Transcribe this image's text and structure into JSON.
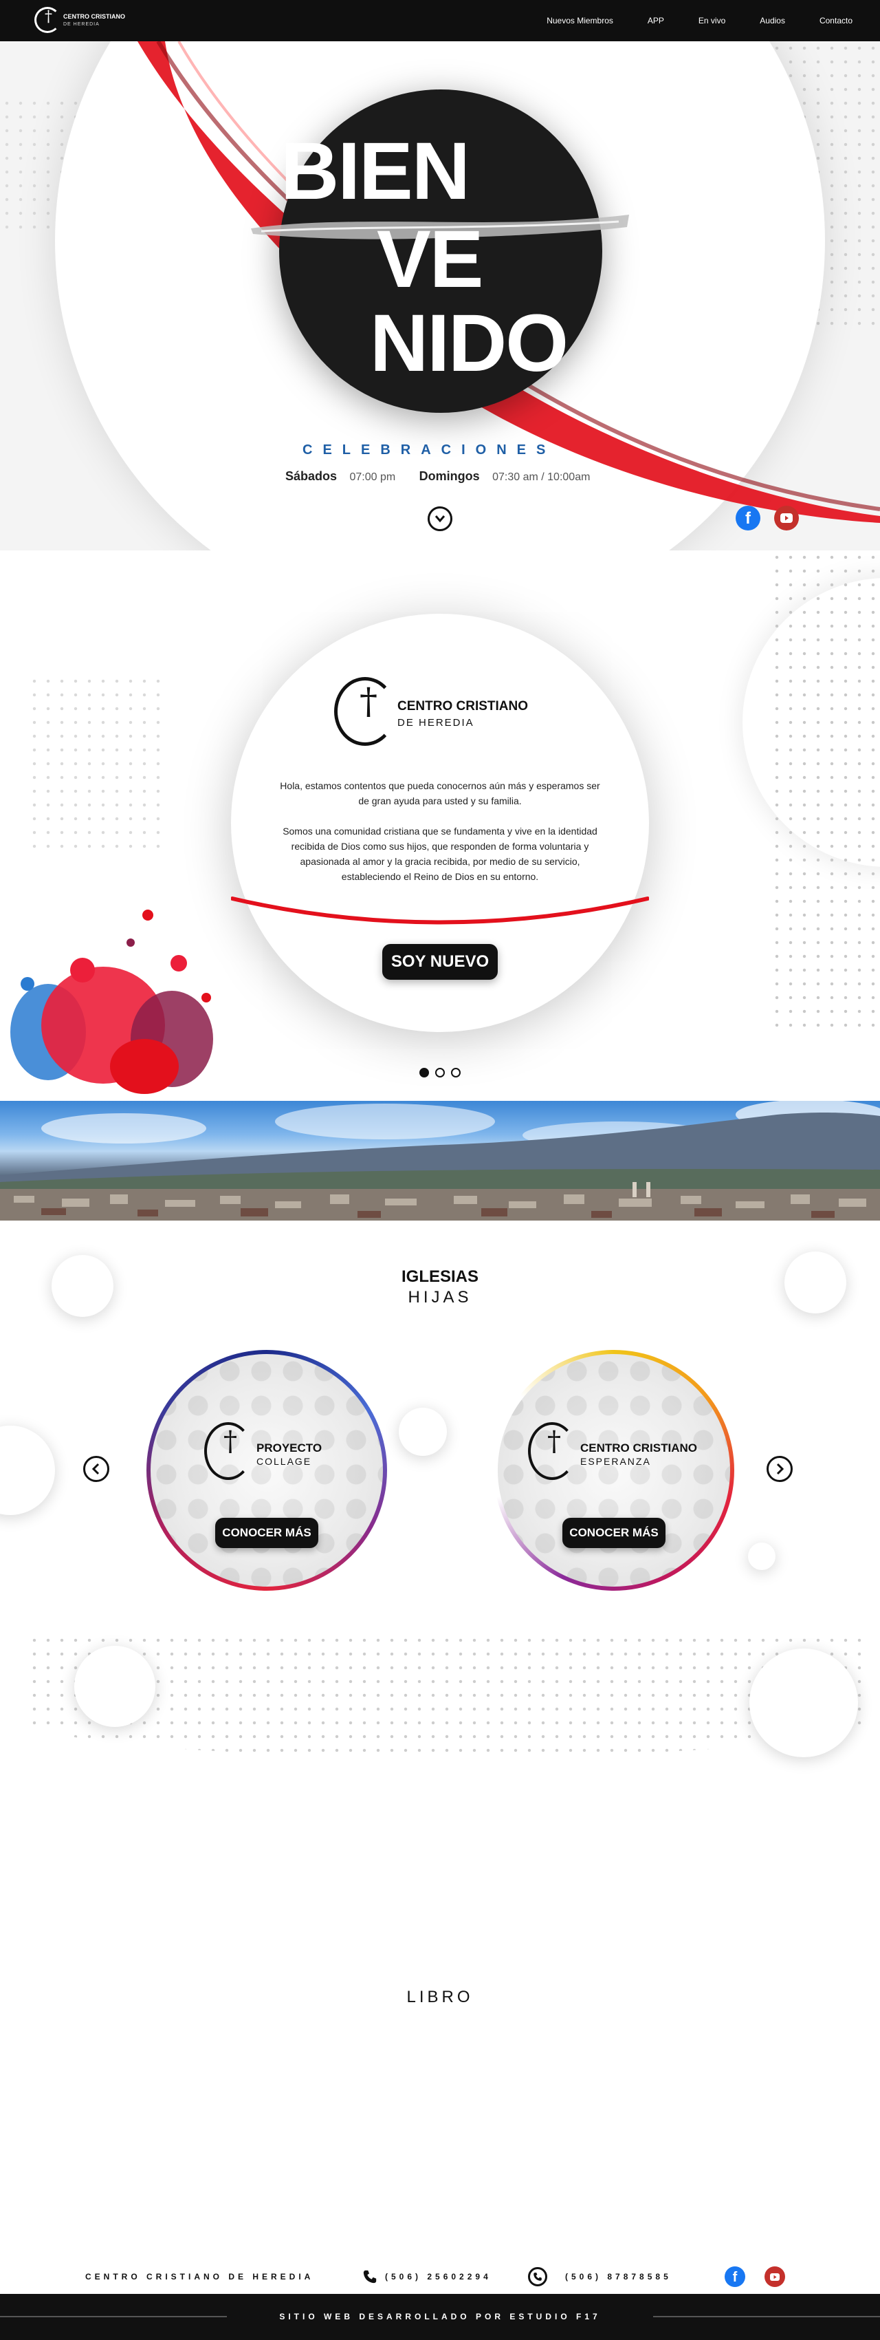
{
  "nav": {
    "logo_line1": "CENTRO CRISTIANO",
    "logo_line2": "DE HEREDIA",
    "links": [
      "Nuevos Miembros",
      "APP",
      "En vivo",
      "Audios",
      "Contacto"
    ]
  },
  "hero": {
    "word1": "BIEN",
    "word2": "VE",
    "word3": "NIDO",
    "celebraciones_label": "CELEBRACIONES",
    "day1": "Sábados",
    "time1": "07:00 pm",
    "day2": "Domingos",
    "time2": "07:30 am / 10:00am",
    "social": [
      "facebook-icon",
      "youtube-icon"
    ]
  },
  "about": {
    "logo_title": "CENTRO CRISTIANO",
    "logo_subtitle": "DE HEREDIA",
    "paragraph1": "Hola, estamos contentos que pueda conocernos aún más y esperamos ser de gran ayuda para usted y su familia.",
    "paragraph2": "Somos una comunidad cristiana que se fundamenta y vive en la identidad recibida de Dios como sus hijos, que responden de forma voluntaria y apasionada al amor y la gracia recibida, por medio de su servicio, estableciendo el Reino de Dios en su entorno.",
    "button": "SOY NUEVO",
    "slides": 3,
    "active_slide": 1
  },
  "hijas": {
    "title_line1": "IGLESIAS",
    "title_line2": "HIJAS",
    "churches": [
      {
        "name1": "PROYECTO",
        "name2": "COLLAGE",
        "button": "CONOCER MÁS"
      },
      {
        "name1": "CENTRO CRISTIANO",
        "name2": "ESPERANZA",
        "button": "CONOCER MÁS"
      }
    ]
  },
  "libro": {
    "title": "LIBRO"
  },
  "footer": {
    "name": "CENTRO CRISTIANO DE HEREDIA",
    "phone": "(506) 25602294",
    "whatsapp": "(506) 87878585",
    "credit": "SITIO WEB DESARROLLADO POR ESTUDIO F17"
  },
  "colors": {
    "accent_red": "#e3101c",
    "accent_blue": "#1f5fa6",
    "dark": "#111111"
  }
}
